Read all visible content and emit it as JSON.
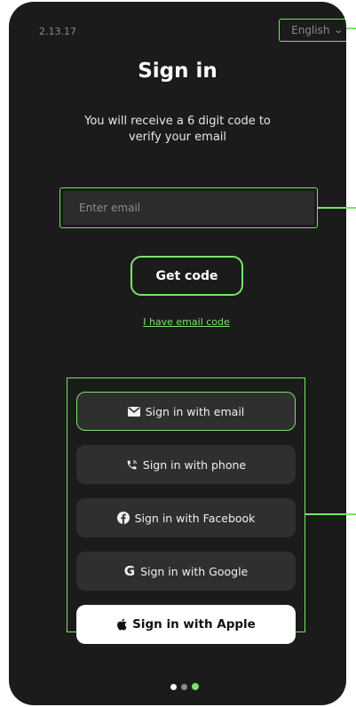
{
  "app": {
    "version": "2.13.17"
  },
  "language": {
    "selected": "English"
  },
  "signin": {
    "title": "Sign in",
    "subtitle": "You will receive a 6 digit code to verify your email",
    "email_placeholder": "Enter email",
    "get_code_label": "Get code",
    "have_code_link": "I have email code"
  },
  "providers": [
    {
      "label": "Sign in with email",
      "icon": "envelope-icon"
    },
    {
      "label": "Sign in with phone",
      "icon": "phone-icon"
    },
    {
      "label": "Sign in with Facebook",
      "icon": "facebook-icon"
    },
    {
      "label": "Sign in with Google",
      "icon": "google-icon"
    },
    {
      "label": "Sign in with Apple",
      "icon": "apple-icon"
    }
  ],
  "pager": {
    "count": 3,
    "current": 3
  },
  "colors": {
    "accent": "#7be36b",
    "background": "#1b1b1b",
    "button": "#2f2f2f"
  }
}
